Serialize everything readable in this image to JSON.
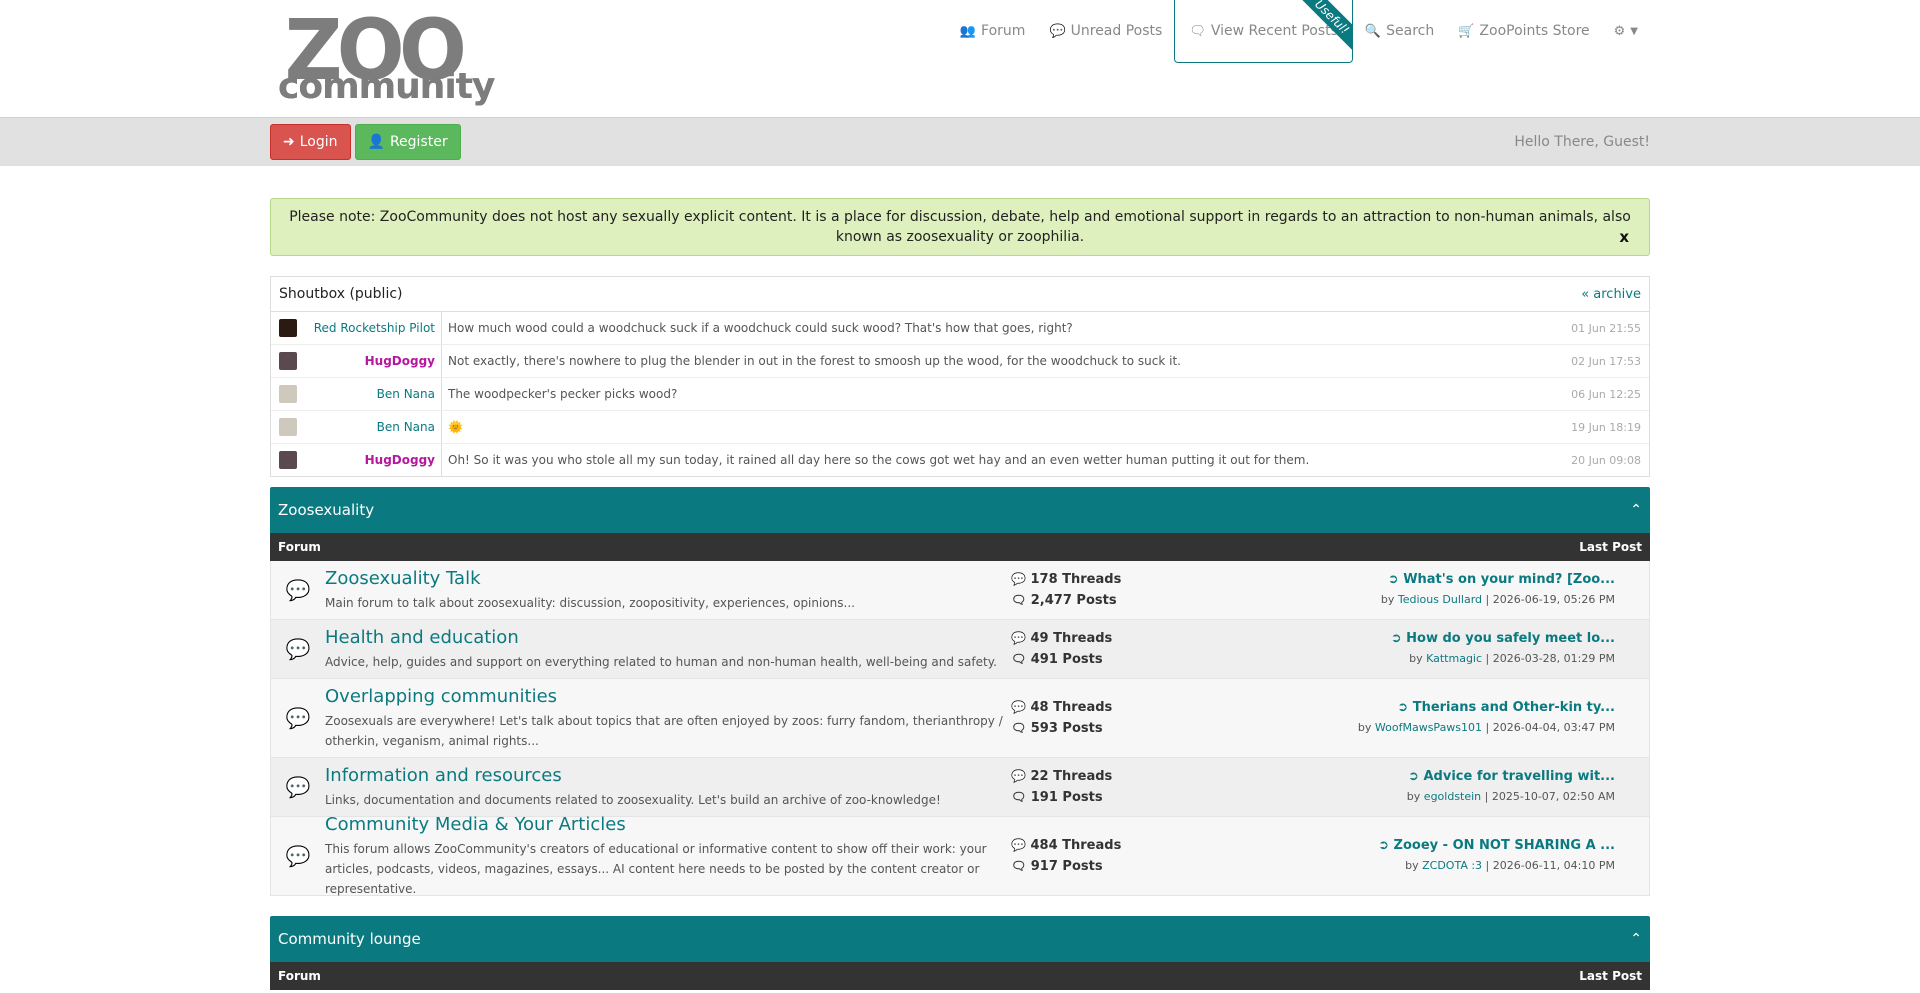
{
  "header": {
    "logo_top": "ZOO",
    "logo_bottom": "community",
    "nav": [
      {
        "label": "Forum",
        "icon": "users-icon"
      },
      {
        "label": "Unread Posts",
        "icon": "comment-icon"
      },
      {
        "label": "View Recent Posts",
        "icon": "comments-icon",
        "ribbon": "Useful!"
      },
      {
        "label": "Search",
        "icon": "search-icon"
      },
      {
        "label": "ZooPoints Store",
        "icon": "cart-icon"
      },
      {
        "label": "",
        "icon": "cogs-icon"
      }
    ]
  },
  "guestbar": {
    "login": "Login",
    "register": "Register",
    "greeting": "Hello There, Guest!"
  },
  "notice": {
    "text": "Please note: ZooCommunity does not host any sexually explicit content. It is a place for discussion, debate, help and emotional support in regards to an attraction to non-human animals, also known as zoosexuality or zoophilia.",
    "close": "x"
  },
  "shoutbox": {
    "title": "Shoutbox (public)",
    "archive": "« archive",
    "rows": [
      {
        "user": "Red Rocketship Pilot",
        "msg": "How much wood could a woodchuck suck if a woodchuck could suck wood? That's how that goes, right?",
        "time": "01 Jun 21:55"
      },
      {
        "user": "HugDoggy",
        "msg": "Not exactly, there's nowhere to plug the blender in out in the forest to smoosh up the wood, for the woodchuck to suck it.",
        "time": "02 Jun 17:53"
      },
      {
        "user": "Ben Nana",
        "msg": "The woodpecker's pecker picks wood?",
        "time": "06 Jun 12:25"
      },
      {
        "user": "Ben Nana",
        "msg": "🌞",
        "time": "19 Jun 18:19"
      },
      {
        "user": "HugDoggy",
        "msg": "Oh! So it was you who stole all my sun today, it rained all day here so the cows got wet hay and an even wetter human putting it out for them.",
        "time": "20 Jun 09:08"
      }
    ]
  },
  "categories": [
    {
      "title": "Zoosexuality",
      "col_forum": "Forum",
      "col_last": "Last Post",
      "forums": [
        {
          "title": "Zoosexuality Talk",
          "desc": "Main forum to talk about zoosexuality: discussion, zoopositivity, experiences, opinions...",
          "threads": "178 Threads",
          "posts": "2,477 Posts",
          "lp_title": "What's on your mind? [Zoo...",
          "lp_by": "by",
          "lp_user": "Tedious Dullard",
          "lp_date": "| 2026-06-19, 05:26 PM"
        },
        {
          "title": "Health and education",
          "desc": "Advice, help, guides and support on everything related to human and non-human health, well-being and safety.",
          "threads": "49 Threads",
          "posts": "491 Posts",
          "lp_title": "How do you safely meet lo...",
          "lp_by": "by",
          "lp_user": "Kattmagic",
          "lp_date": "| 2026-03-28, 01:29 PM"
        },
        {
          "title": "Overlapping communities",
          "desc": "Zoosexuals are everywhere! Let's talk about topics that are often enjoyed by zoos: furry fandom, therianthropy / otherkin, veganism, animal rights...",
          "threads": "48 Threads",
          "posts": "593 Posts",
          "lp_title": "Therians and Other-kin ty...",
          "lp_by": "by",
          "lp_user": "WoofMawsPaws101",
          "lp_date": "| 2026-04-04, 03:47 PM"
        },
        {
          "title": "Information and resources",
          "desc": "Links, documentation and documents related to zoosexuality. Let's build an archive of zoo-knowledge!",
          "threads": "22 Threads",
          "posts": "191 Posts",
          "lp_title": "Advice for travelling wit...",
          "lp_by": "by",
          "lp_user": "egoldstein",
          "lp_date": "| 2025-10-07, 02:50 AM"
        },
        {
          "title": "Community Media & Your Articles",
          "desc": "This forum allows ZooCommunity's creators of educational or informative content to show off their work: your articles, podcasts, videos, magazines, essays... AI content here needs to be posted by the content creator or representative.",
          "threads": "484 Threads",
          "posts": "917 Posts",
          "lp_title": "Zooey - ON NOT SHARING A ...",
          "lp_by": "by",
          "lp_user": "ZCDOTA :3",
          "lp_date": "| 2026-06-11, 04:10 PM"
        }
      ]
    },
    {
      "title": "Community lounge",
      "col_forum": "Forum",
      "col_last": "Last Post",
      "forums": []
    }
  ]
}
